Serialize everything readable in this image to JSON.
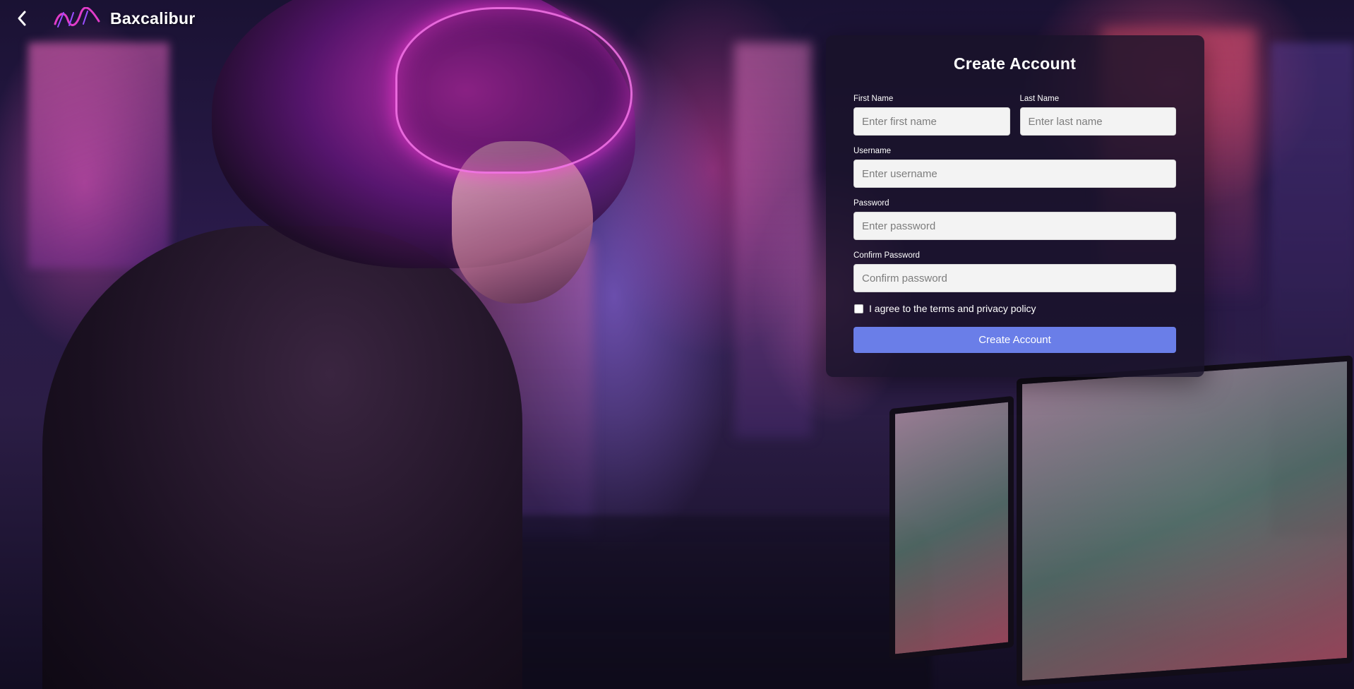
{
  "app": {
    "brand_name": "Baxcalibur",
    "logo_text": "Baxcalibur",
    "back_icon": "chevron-left-icon"
  },
  "form": {
    "title": "Create Account",
    "first_name": {
      "label": "First Name",
      "placeholder": "Enter first name"
    },
    "last_name": {
      "label": "Last Name",
      "placeholder": "Enter last name"
    },
    "username": {
      "label": "Username",
      "placeholder": "Enter username"
    },
    "password": {
      "label": "Password",
      "placeholder": "Enter password"
    },
    "confirm_password": {
      "label": "Confirm Password",
      "placeholder": "Confirm password"
    },
    "agree_text": "I agree to the terms and privacy policy",
    "submit_label": "Create Account"
  },
  "colors": {
    "accent": "#6a7ee8",
    "card_bg": "#19122a",
    "logo": "#e03cc8"
  }
}
